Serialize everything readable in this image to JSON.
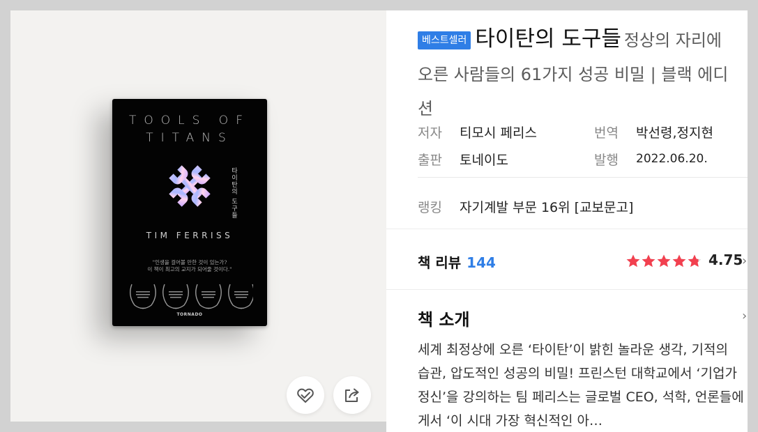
{
  "cover": {
    "title_line1": "TOOLS OF",
    "title_line2": "TITANS",
    "vertical_title": "타이탄의 도구들",
    "author": "TIM FERRISS",
    "quote_line1": "\"인생을 걸어볼 만한 것이 있는가?",
    "quote_line2": "이 책이 최고의 교지가 되어줄 것이다.\"",
    "publisher": "TORNADO"
  },
  "actions": {
    "like_icon": "heart-check-icon",
    "share_icon": "share-icon"
  },
  "book": {
    "badge": "베스트셀러",
    "title": "타이탄의 도구들",
    "subtitle": "정상의 자리에 오른 사람들의 61가지 성공 비밀 | 블랙 에디션",
    "author_label": "저자",
    "author": "티모시 페리스",
    "translator_label": "번역",
    "translator": "박선령,정지현",
    "publisher_label": "출판",
    "publisher": "토네이도",
    "date_label": "발행",
    "date": "2022.06.20.",
    "ranking_label": "랭킹",
    "ranking": "자기계발 부문 16위 [교보문고]"
  },
  "review": {
    "label": "책 리뷰",
    "count": "144",
    "rating": 4.75,
    "rating_text": "4.75",
    "star_color": "#f2404f"
  },
  "intro": {
    "heading": "책 소개",
    "body": "세계 최정상에 오른 ‘타이탄’이 밝힌 놀라운 생각, 기적의 습관, 압도적인 성공의 비밀! 프린스턴 대학교에서 ‘기업가정신’을 강의하는 팀 페리스는 글로벌 CEO, 석학, 언론들에게서 ‘이 시대 가장 혁신적인 아…"
  },
  "colors": {
    "accent": "#2f7ee6",
    "page_bg": "#d2d2d2",
    "cover_bg": "#030303"
  }
}
